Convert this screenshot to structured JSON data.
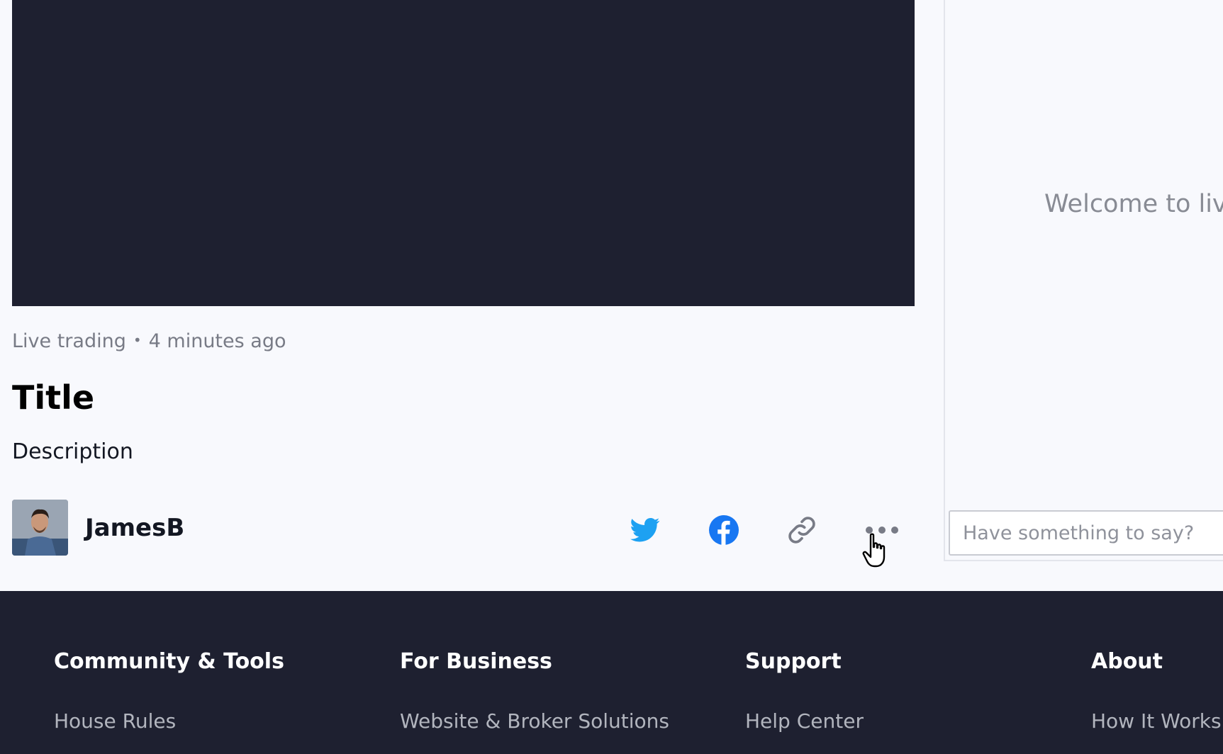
{
  "post": {
    "category": "Live trading",
    "separator": "•",
    "time_ago": "4 minutes ago",
    "title": "Title",
    "description": "Description",
    "author": "JamesB"
  },
  "share": {
    "icons": [
      "twitter-icon",
      "facebook-icon",
      "link-icon",
      "more-icon"
    ],
    "colors": {
      "twitter": "#1da1f2",
      "facebook": "#1877f2",
      "link": "#787b86",
      "more": "#787b86"
    }
  },
  "chat": {
    "welcome": "Welcome to live",
    "placeholder": "Have something to say?"
  },
  "footer": {
    "columns": [
      {
        "heading": "Community & Tools",
        "link": "House Rules"
      },
      {
        "heading": "For Business",
        "link": "Website & Broker Solutions"
      },
      {
        "heading": "Support",
        "link": "Help Center"
      },
      {
        "heading": "About",
        "link": "How It Works"
      }
    ]
  },
  "colors": {
    "dark_bg": "#1e2030",
    "page_bg": "#f8f9fd"
  }
}
